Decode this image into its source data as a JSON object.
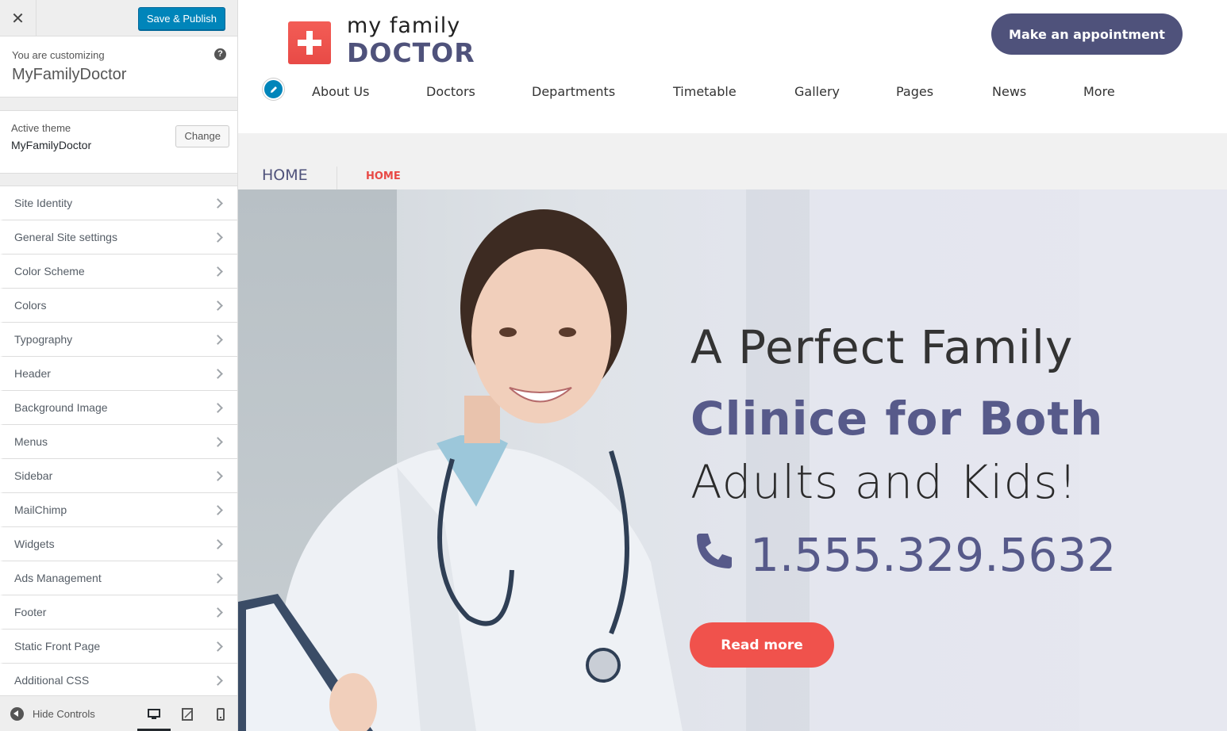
{
  "customizer": {
    "close_icon": "close-icon",
    "save_label": "Save & Publish",
    "customizing_label": "You are customizing",
    "site_name": "MyFamilyDoctor",
    "help_glyph": "?",
    "active_theme_label": "Active theme",
    "active_theme_name": "MyFamilyDoctor",
    "change_label": "Change",
    "sections": [
      {
        "label": "Site Identity"
      },
      {
        "label": "General Site settings"
      },
      {
        "label": "Color Scheme"
      },
      {
        "label": "Colors"
      },
      {
        "label": "Typography"
      },
      {
        "label": "Header"
      },
      {
        "label": "Background Image"
      },
      {
        "label": "Menus"
      },
      {
        "label": "Sidebar"
      },
      {
        "label": "MailChimp"
      },
      {
        "label": "Widgets"
      },
      {
        "label": "Ads Management"
      },
      {
        "label": "Footer"
      },
      {
        "label": "Static Front Page"
      },
      {
        "label": "Additional CSS"
      }
    ],
    "hide_controls_label": "Hide Controls",
    "devices": [
      "desktop-icon",
      "tablet-icon",
      "mobile-icon"
    ],
    "active_device": "desktop"
  },
  "site": {
    "logo_line1": "my family",
    "logo_line2": "DOCTOR",
    "appointment_label": "Make an appointment",
    "nav": [
      {
        "label": "About Us"
      },
      {
        "label": "Doctors"
      },
      {
        "label": "Departments"
      },
      {
        "label": "Timetable"
      },
      {
        "label": "Gallery"
      },
      {
        "label": "Pages"
      },
      {
        "label": "News"
      },
      {
        "label": "More"
      }
    ],
    "page_title": "HOME",
    "breadcrumb": "HOME",
    "hero": {
      "line1": "A Perfect Family",
      "line2": "Clinice for Both",
      "line3": "Adults and Kids!",
      "phone": "1.555.329.5632",
      "button": "Read more"
    },
    "colors": {
      "brand_purple": "#4f527b",
      "accent_red": "#f0524c",
      "wp_blue": "#0085ba"
    }
  }
}
